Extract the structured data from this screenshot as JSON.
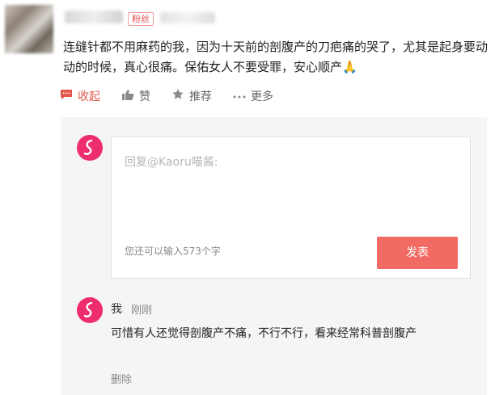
{
  "post": {
    "badge": "粉丝",
    "text": "连缝针都不用麻药的我，因为十天前的剖腹产的刀疤痛的哭了，尤其是起身要动动的时候，真心很痛。保佑女人不要受罪，安心顺产🙏"
  },
  "actions": {
    "favorite": "收起",
    "like": "赞",
    "recommend": "推荐",
    "more": "更多"
  },
  "reply": {
    "placeholder": "回复@Kaoru喵酱:",
    "counter": "您还可以输入573个字",
    "submit": "发表"
  },
  "comment": {
    "user": "我",
    "time": "刚刚",
    "text": "可惜有人还觉得剖腹产不痛，不行不行，看来经常科普剖腹产",
    "delete": "删除"
  },
  "colors": {
    "accent": "#f26a64",
    "brand_icon": "#ee2e6c",
    "badge_border": "#f29a9a"
  },
  "icons": [
    "comment-icon",
    "thumbs-up-icon",
    "pin-icon",
    "more-dots-icon",
    "brand-logo-icon"
  ]
}
